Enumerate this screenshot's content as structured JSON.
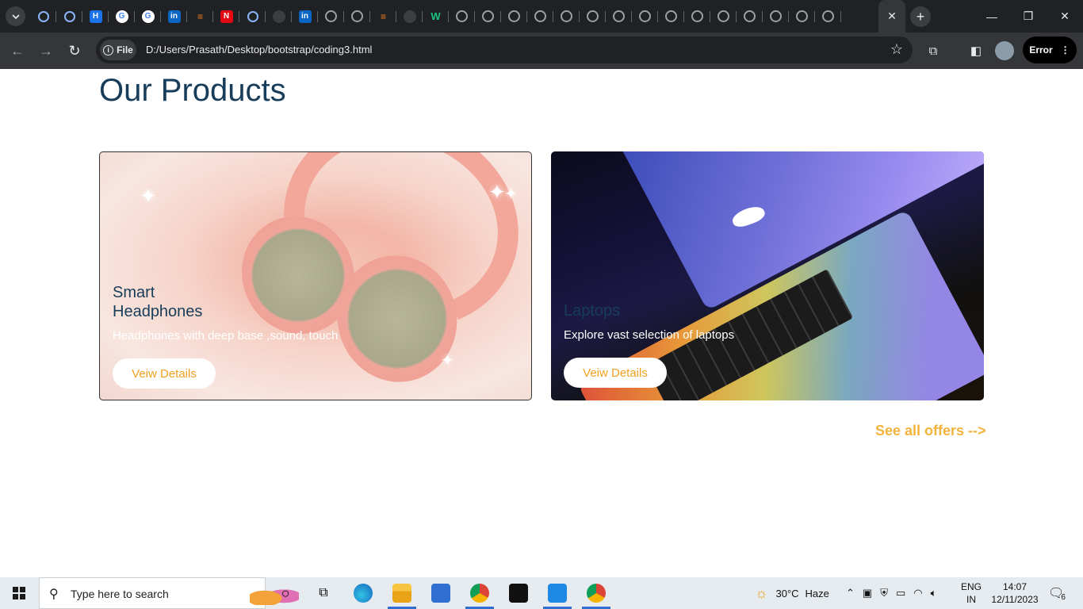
{
  "browser": {
    "active_tab_close": "✕",
    "new_tab": "+",
    "window_controls": {
      "minimize": "—",
      "restore": "❐",
      "close": "✕"
    },
    "address": {
      "chip_label": "File",
      "url": "D:/Users/Prasath/Desktop/bootstrap/coding3.html"
    },
    "profile_error_label": "Error",
    "tabs": [
      "react-icon",
      "react-icon",
      "h-icon",
      "google-icon",
      "google-icon",
      "linkedin-icon",
      "stackoverflow-icon",
      "n-icon",
      "react-icon",
      "github-icon",
      "linkedin-icon",
      "globe-icon",
      "globe-icon",
      "stackoverflow-icon",
      "github-icon",
      "w-icon",
      "globe-icon",
      "globe-icon",
      "globe-icon",
      "globe-icon",
      "globe-icon",
      "globe-icon",
      "globe-icon",
      "globe-icon",
      "globe-icon",
      "globe-icon",
      "globe-icon",
      "globe-icon",
      "globe-icon",
      "globe-icon",
      "globe-icon"
    ]
  },
  "page": {
    "heading": "Our Products",
    "cards": [
      {
        "title": "Smart Headphones",
        "description": "Headphones with deep base ,sound, touch",
        "button": "Veiw Details"
      },
      {
        "title": "Laptops",
        "description": "Explore vast selection of laptops",
        "button": "Veiw Details"
      }
    ],
    "see_all": "See all offers -->"
  },
  "taskbar": {
    "search_placeholder": "Type here to search",
    "weather_temp": "30°C",
    "weather_desc": "Haze",
    "lang_top": "ENG",
    "lang_bottom": "IN",
    "time": "14:07",
    "date": "12/11/2023",
    "notification_count": "6"
  },
  "colors": {
    "heading": "#173d5a",
    "button_text": "#f0a020",
    "see_all": "#f3b33d"
  }
}
